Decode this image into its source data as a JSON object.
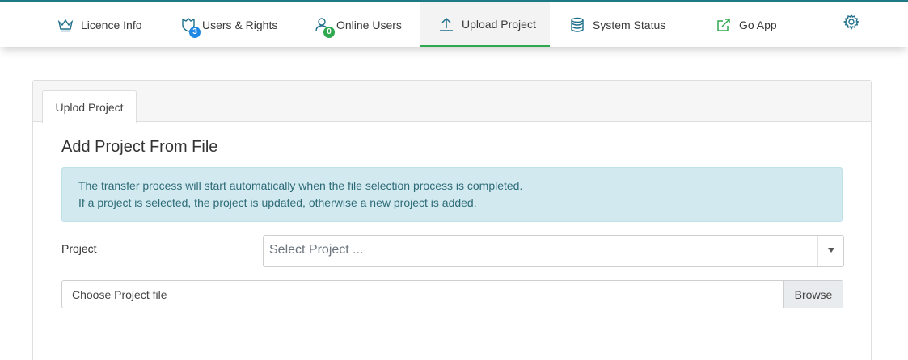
{
  "colors": {
    "accent_bar": "#1f7a86",
    "active_underline": "#2fa84f",
    "icon_blue": "#1f6f8b",
    "icon_green": "#2fa84f",
    "badge_blue": "#1e88e5",
    "badge_green": "#2fa84f",
    "alert_bg": "#d1e9ef",
    "alert_text": "#2e6b78"
  },
  "nav": {
    "items": [
      {
        "label": "Licence Info",
        "icon": "crown-icon"
      },
      {
        "label": "Users & Rights",
        "icon": "users-rights-icon",
        "badge": "3"
      },
      {
        "label": "Online Users",
        "icon": "online-user-icon",
        "badge": "0"
      },
      {
        "label": "Upload Project",
        "icon": "upload-icon",
        "active": true
      },
      {
        "label": "System Status",
        "icon": "database-icon"
      },
      {
        "label": "Go App",
        "icon": "external-link-icon"
      }
    ],
    "settings_icon": "gear-icon"
  },
  "card": {
    "tab_label": "Uplod Project",
    "title": "Add Project From File",
    "alert": {
      "line1": "The transfer process will start automatically when the file selection process is completed.",
      "line2": "If a project is selected, the project is updated, otherwise a new project is added."
    },
    "project_label": "Project",
    "project_select_placeholder": "Select Project ...",
    "file_label": "Choose Project file",
    "browse_label": "Browse"
  }
}
